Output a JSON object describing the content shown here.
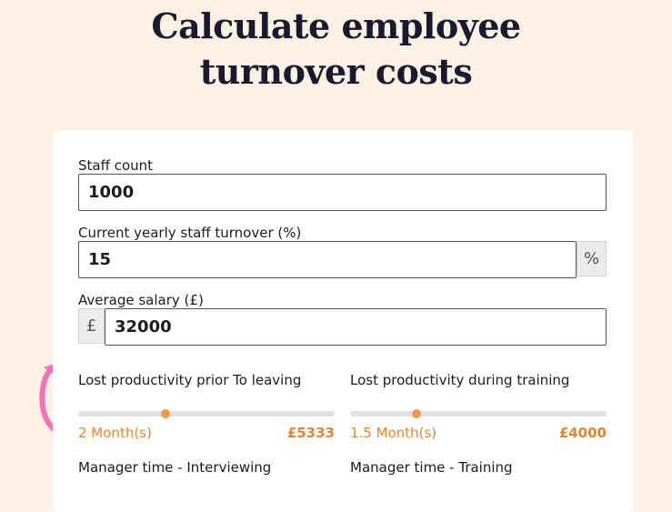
{
  "title": {
    "line1": "Calculate employee",
    "line2": "turnover costs"
  },
  "form": {
    "staff_count": {
      "label": "Staff count",
      "value": "1000"
    },
    "turnover": {
      "label": "Current yearly staff turnover (%)",
      "value": "15",
      "suffix": "%"
    },
    "salary": {
      "label": "Average salary (£)",
      "value": "32000",
      "prefix": "£"
    }
  },
  "sliders": [
    {
      "label": "Lost productivity prior To leaving",
      "value_text": "2 Month(s)",
      "cost": "£5333",
      "position": 0.34
    },
    {
      "label": "Lost productivity during training",
      "value_text": "1.5 Month(s)",
      "cost": "£4000",
      "position": 0.26
    }
  ],
  "next_labels": {
    "interviewing": "Manager time - Interviewing",
    "training": "Manager time - Training"
  },
  "colors": {
    "background": "#fdf0e4",
    "accent": "#f3994b",
    "accent_text": "#e8832f",
    "arrow": "#f472b6"
  }
}
